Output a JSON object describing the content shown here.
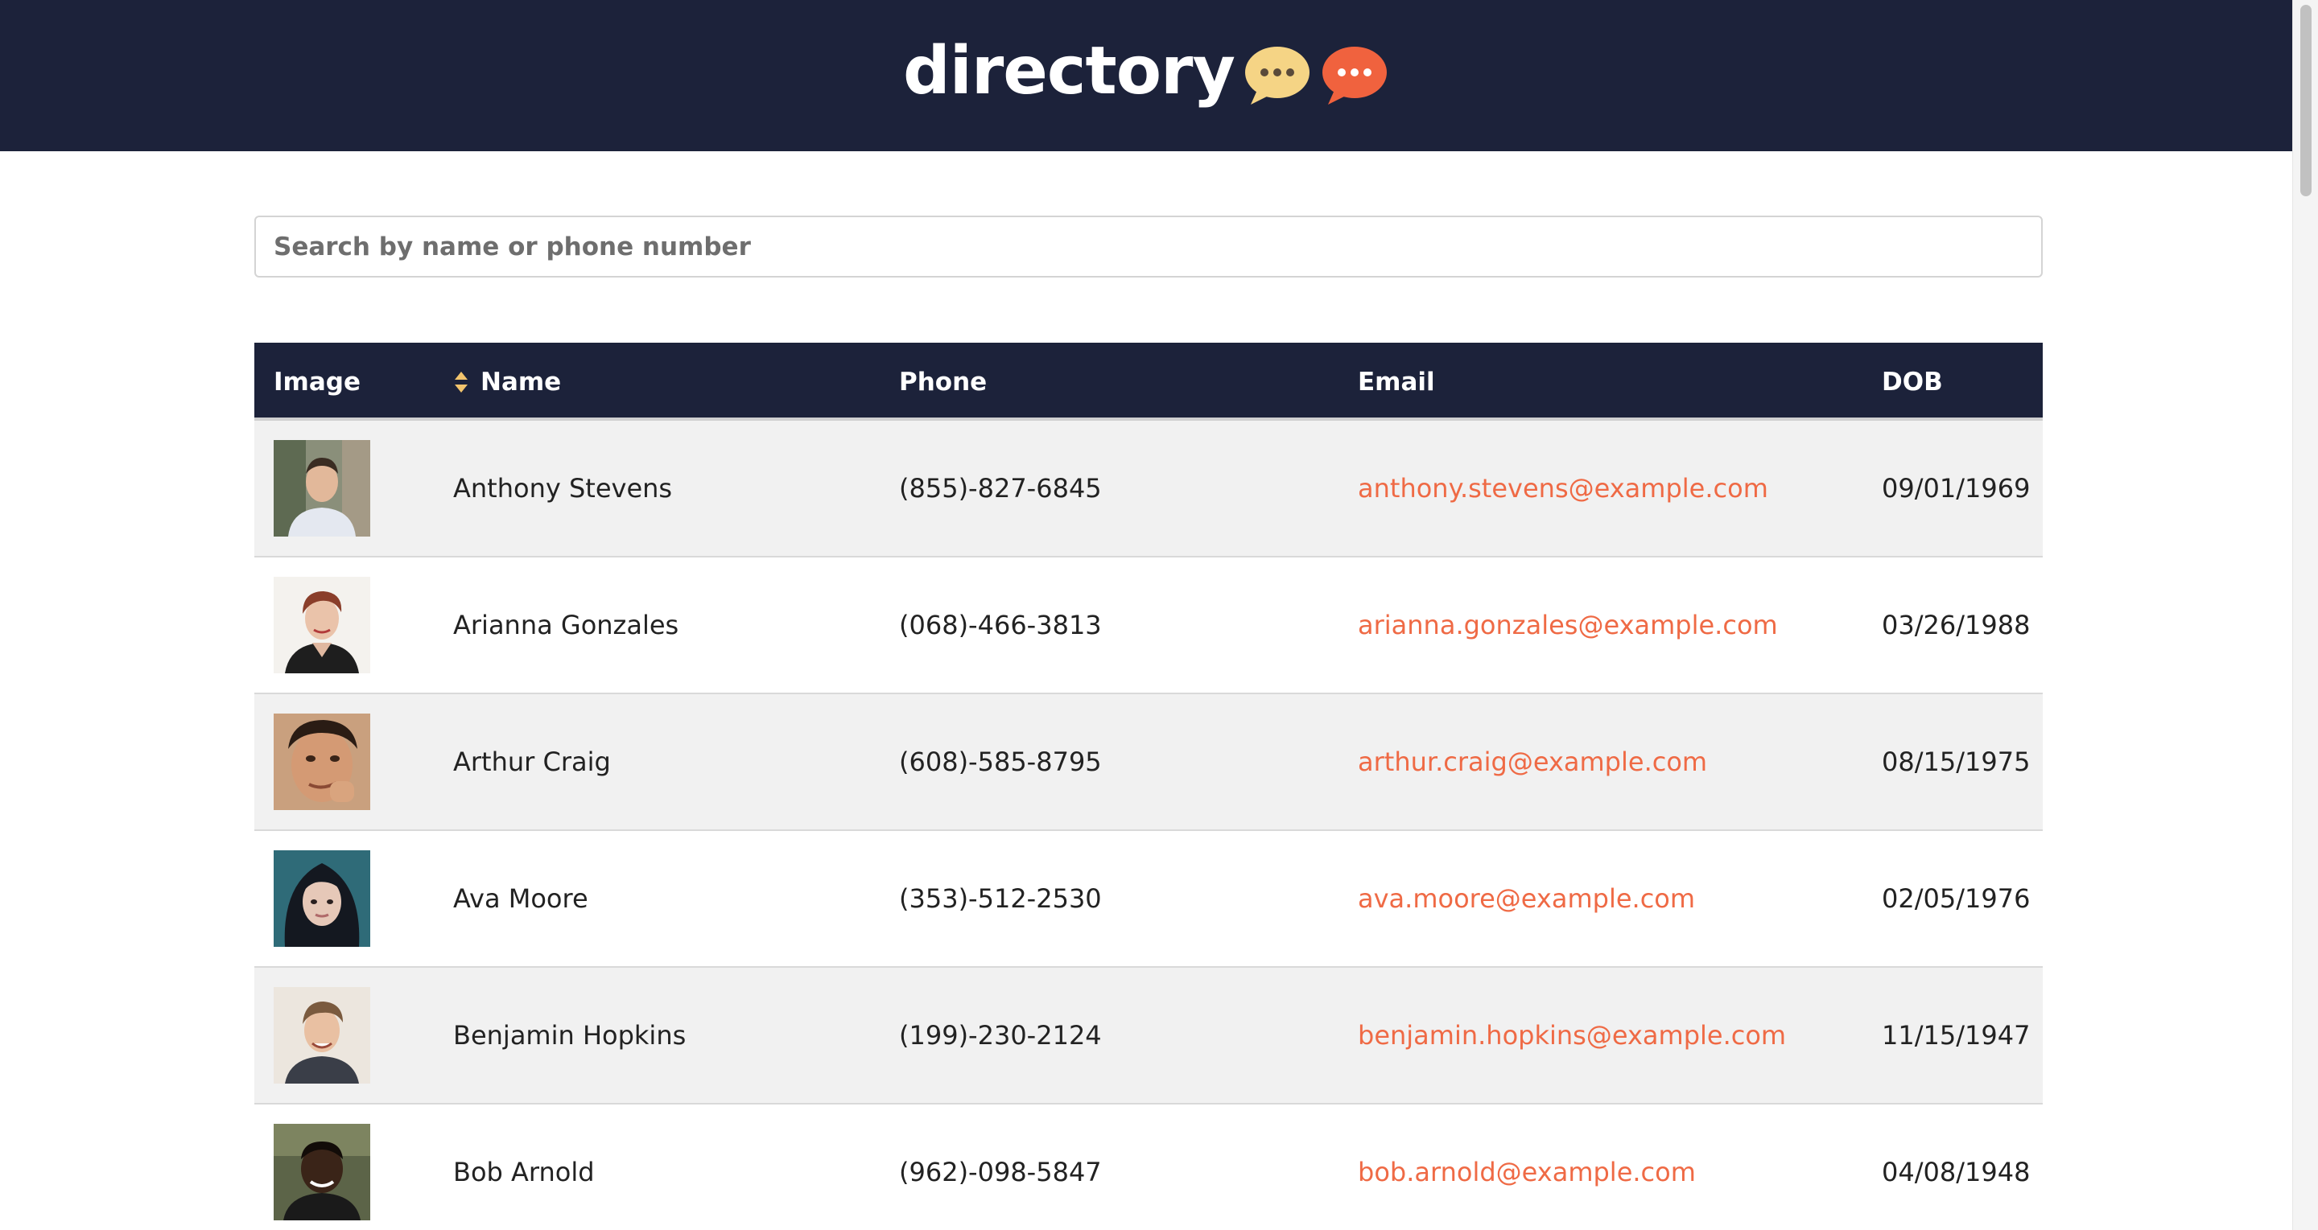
{
  "header": {
    "title": "directory",
    "bubble_left_color": "#f5d485",
    "bubble_right_color": "#f0623e"
  },
  "search": {
    "placeholder": "Search by name or phone number",
    "value": ""
  },
  "table": {
    "columns": {
      "image": "Image",
      "name": "Name",
      "phone": "Phone",
      "email": "Email",
      "dob": "DOB"
    },
    "sort_icon": "sort-icon",
    "rows": [
      {
        "name": "Anthony Stevens",
        "phone": "(855)-827-6845",
        "email": "anthony.stevens@example.com",
        "dob": "09/01/1969"
      },
      {
        "name": "Arianna Gonzales",
        "phone": "(068)-466-3813",
        "email": "arianna.gonzales@example.com",
        "dob": "03/26/1988"
      },
      {
        "name": "Arthur Craig",
        "phone": "(608)-585-8795",
        "email": "arthur.craig@example.com",
        "dob": "08/15/1975"
      },
      {
        "name": "Ava Moore",
        "phone": "(353)-512-2530",
        "email": "ava.moore@example.com",
        "dob": "02/05/1976"
      },
      {
        "name": "Benjamin Hopkins",
        "phone": "(199)-230-2124",
        "email": "benjamin.hopkins@example.com",
        "dob": "11/15/1947"
      },
      {
        "name": "Bob Arnold",
        "phone": "(962)-098-5847",
        "email": "bob.arnold@example.com",
        "dob": "04/08/1948"
      }
    ]
  },
  "colors": {
    "navy": "#1c223a",
    "accent": "#ef6a45",
    "row_shade": "#f1f1f1",
    "sort_icon": "#f2c46d"
  }
}
